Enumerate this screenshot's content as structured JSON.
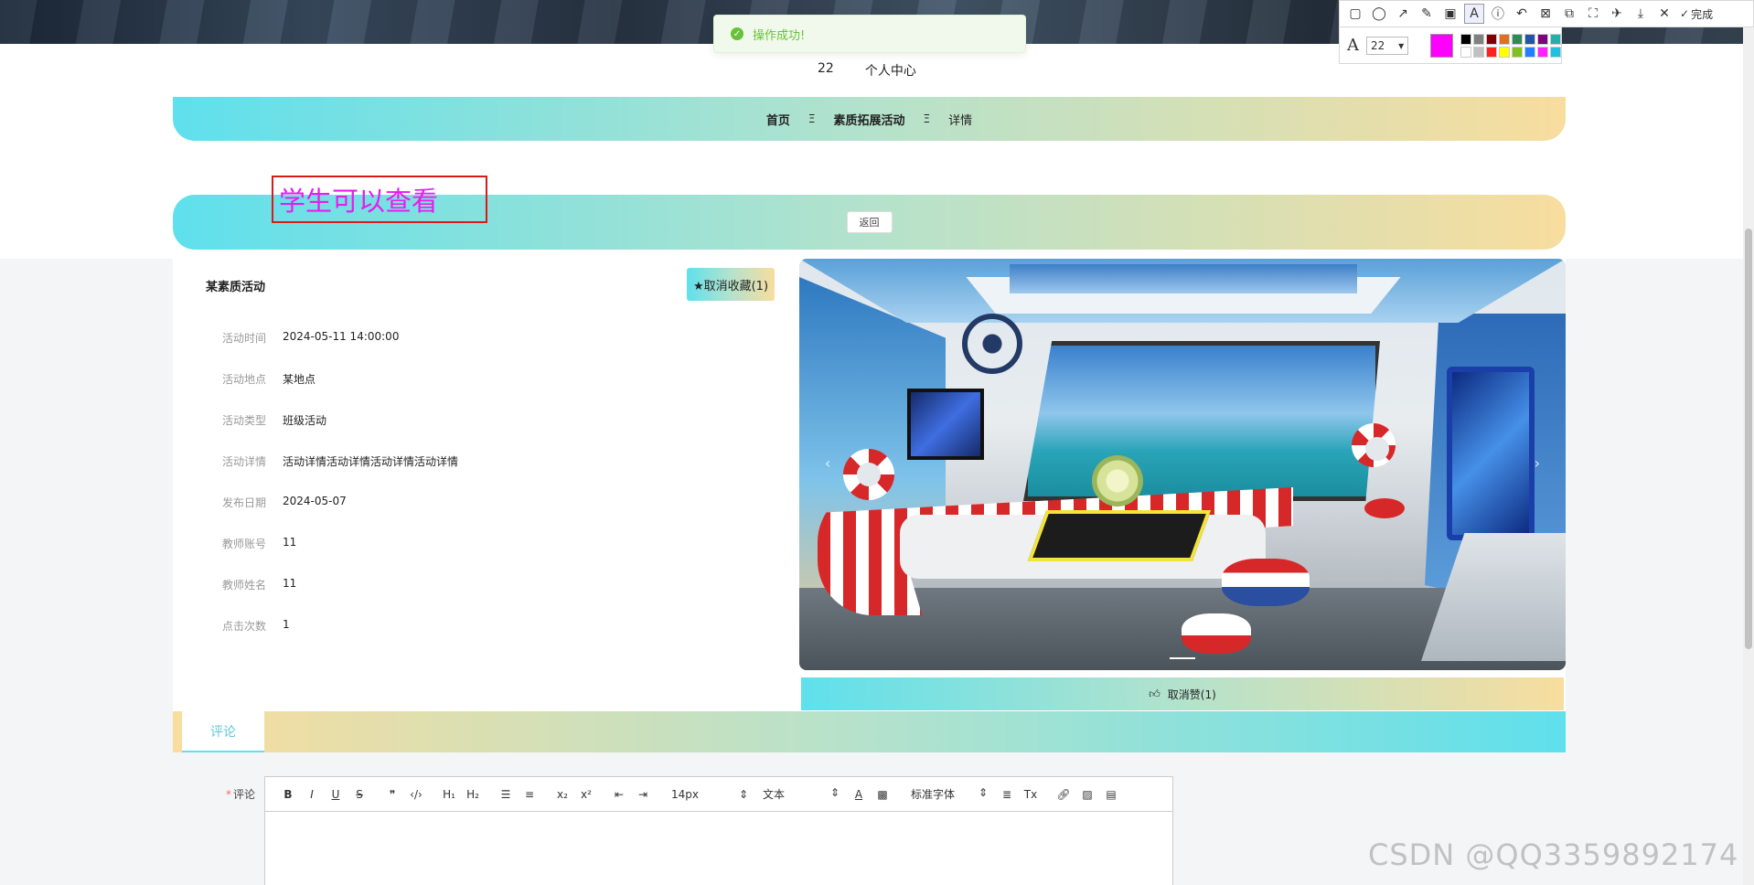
{
  "toast": {
    "message": "操作成功!"
  },
  "snip_toolbar": {
    "done_label": "完成",
    "font_size": "22",
    "current_color": "#ff00ff",
    "palette": [
      "#000000",
      "#808080",
      "#800000",
      "#e07020",
      "#2e8b57",
      "#2255aa",
      "#800080",
      "#20b2aa",
      "#ffffff",
      "#c0c0c0",
      "#ff2020",
      "#ffff00",
      "#80c020",
      "#2080ff",
      "#ff20ff",
      "#20c0e0"
    ]
  },
  "user_bar": {
    "username": "22",
    "center_link": "个人中心"
  },
  "breadcrumb": {
    "home": "首页",
    "sep": "Ξ",
    "section": "素质拓展活动",
    "current": "详情"
  },
  "annotation": {
    "text": "学生可以查看"
  },
  "back_button": "返回",
  "activity": {
    "title": "某素质活动",
    "favorite_button": "★取消收藏(1)",
    "fields": [
      {
        "label": "活动时间",
        "value": "2024-05-11 14:00:00"
      },
      {
        "label": "活动地点",
        "value": "某地点"
      },
      {
        "label": "活动类型",
        "value": "班级活动"
      },
      {
        "label": "活动详情",
        "value": "活动详情活动详情活动详情活动详情"
      },
      {
        "label": "发布日期",
        "value": "2024-05-07"
      },
      {
        "label": "教师账号",
        "value": "11"
      },
      {
        "label": "教师姓名",
        "value": "11"
      },
      {
        "label": "点击次数",
        "value": "1"
      }
    ],
    "like_button": "取消赞(1)"
  },
  "tabs": {
    "comment": "评论"
  },
  "comment_form": {
    "label": "评论",
    "required_mark": "*",
    "font_size": "14px",
    "header_picker": "文本",
    "font_family": "标准字体"
  },
  "watermark": "CSDN @QQ3359892174"
}
